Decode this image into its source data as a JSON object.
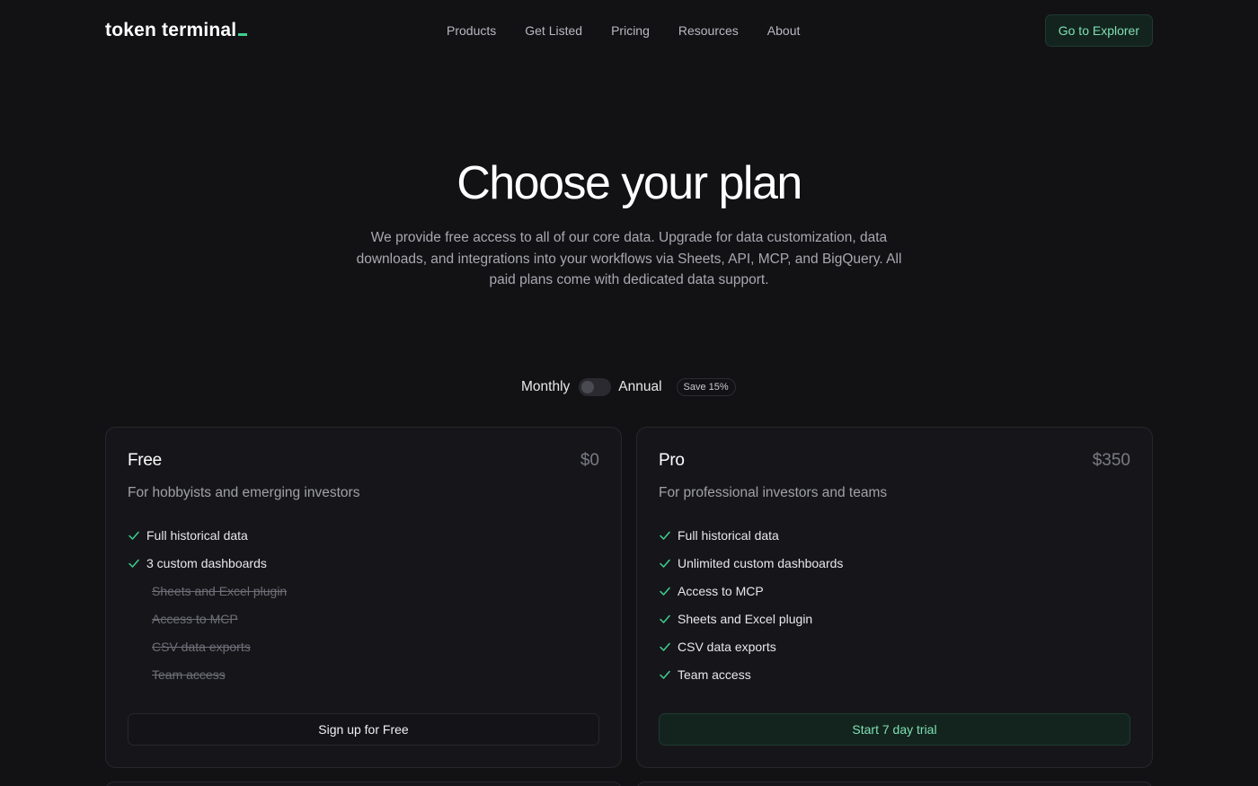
{
  "header": {
    "logo_text": "token terminal",
    "nav": [
      "Products",
      "Get Listed",
      "Pricing",
      "Resources",
      "About"
    ],
    "cta_label": "Go to Explorer"
  },
  "hero": {
    "title": "Choose your plan",
    "subtitle": "We provide free access to all of our core data. Upgrade for data customization, data downloads, and integrations into your workflows via Sheets, API, MCP, and BigQuery. All paid plans come with dedicated data support."
  },
  "billing": {
    "monthly_label": "Monthly",
    "annual_label": "Annual",
    "badge": "Save 15%"
  },
  "plans": {
    "free": {
      "name": "Free",
      "price": "$0",
      "description": "For hobbyists and emerging investors",
      "features": [
        {
          "label": "Full historical data",
          "included": true
        },
        {
          "label": "3 custom dashboards",
          "included": true
        },
        {
          "label": "Sheets and Excel plugin",
          "included": false
        },
        {
          "label": "Access to MCP",
          "included": false
        },
        {
          "label": "CSV data exports",
          "included": false
        },
        {
          "label": "Team access",
          "included": false
        }
      ],
      "button_label": "Sign up for Free"
    },
    "pro": {
      "name": "Pro",
      "price": "$350",
      "description": "For professional investors and teams",
      "features": [
        {
          "label": "Full historical data",
          "included": true
        },
        {
          "label": "Unlimited custom dashboards",
          "included": true
        },
        {
          "label": "Access to MCP",
          "included": true
        },
        {
          "label": "Sheets and Excel plugin",
          "included": true
        },
        {
          "label": "CSV data exports",
          "included": true
        },
        {
          "label": "Team access",
          "included": true
        }
      ],
      "button_label": "Start 7 day trial"
    }
  },
  "colors": {
    "accent": "#3ecf8e",
    "background": "#121215"
  }
}
